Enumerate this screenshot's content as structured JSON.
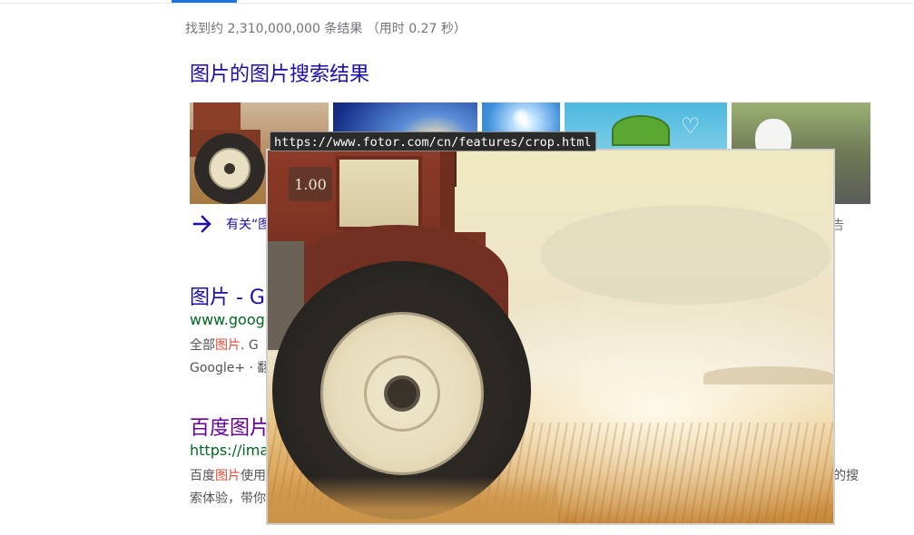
{
  "stats": "找到约 2,310,000,000 条结果 （用时 0.27 秒）",
  "image_section": {
    "title": "图片的图片搜索结果",
    "more_link": "有关“图",
    "more_tail": "告"
  },
  "results": [
    {
      "title": "图片 - Go",
      "url": "www.googl",
      "snippet_line1_pre": "全部",
      "snippet_line1_hl": "图片",
      "snippet_line1_post": ". G",
      "snippet_line2": "Google+ · 翻"
    },
    {
      "title": "百度图片",
      "url": "https://imag",
      "snippet_line1_pre": "百度",
      "snippet_line1_hl": "图片",
      "snippet_line1_post": "使用",
      "snippet_line1_tail": "的搜",
      "snippet_line2": "索体验，带你"
    }
  ],
  "preview": {
    "url_tooltip": "https://www.fotor.com/cn/features/crop.html",
    "zoom": "1.00"
  },
  "colors": {
    "link": "#1a0dab",
    "visited": "#660099",
    "url_green": "#006621",
    "highlight": "#dd4b39",
    "accent": "#1a73e8"
  }
}
